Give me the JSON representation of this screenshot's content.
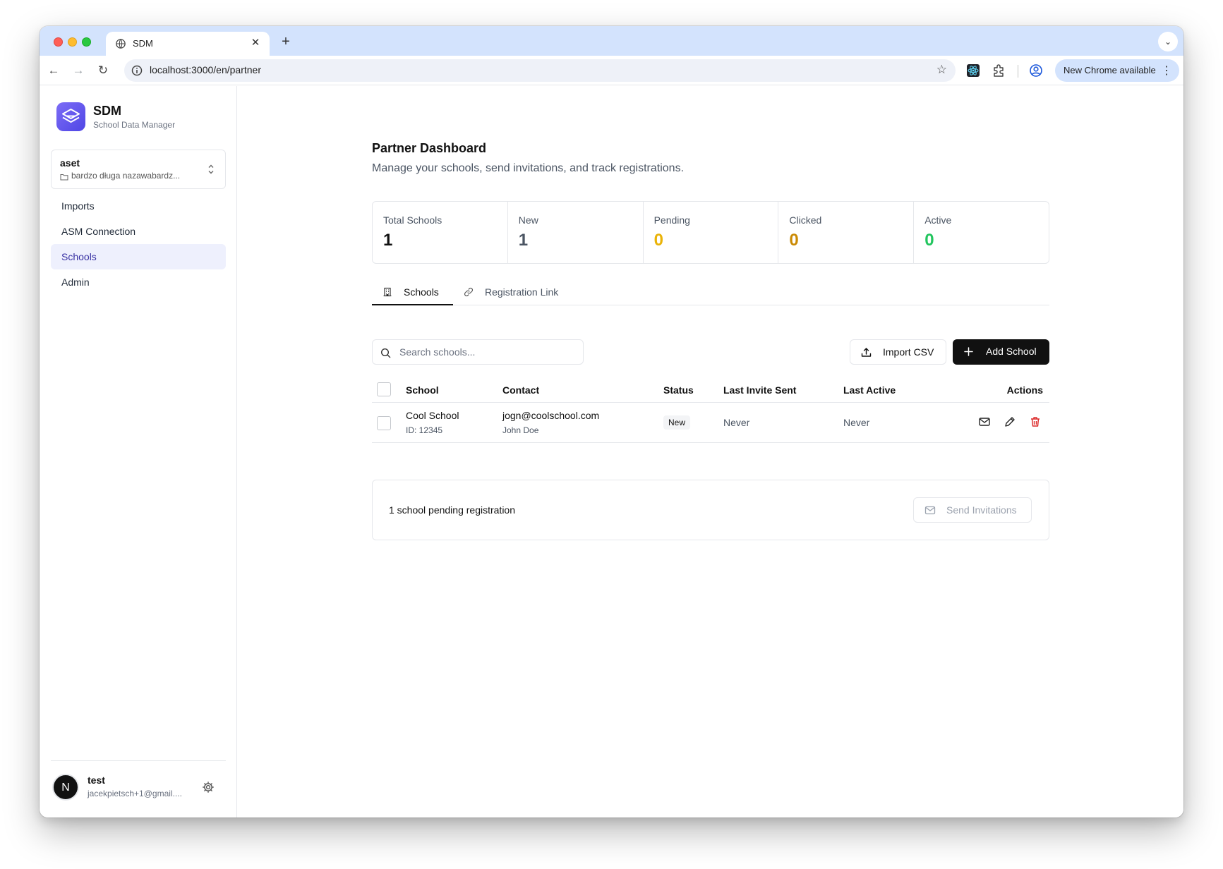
{
  "browser": {
    "tab_title": "SDM",
    "url": "localhost:3000/en/partner",
    "update_label": "New Chrome available"
  },
  "sidebar": {
    "brand_name": "SDM",
    "brand_subtitle": "School Data Manager",
    "org": {
      "name": "aset",
      "path": "bardzo długa nazawabardz..."
    },
    "nav": [
      {
        "label": "Imports"
      },
      {
        "label": "ASM Connection"
      },
      {
        "label": "Schools",
        "active": true
      },
      {
        "label": "Admin"
      }
    ],
    "user": {
      "initial": "N",
      "name": "test",
      "email": "jacekpietsch+1@gmail...."
    }
  },
  "main": {
    "title": "Partner Dashboard",
    "subtitle": "Manage your schools, send invitations, and track registrations.",
    "stats": [
      {
        "label": "Total Schools",
        "value": "1",
        "color": "#111111"
      },
      {
        "label": "New",
        "value": "1",
        "color": "#4b5563"
      },
      {
        "label": "Pending",
        "value": "0",
        "color": "#eab308"
      },
      {
        "label": "Clicked",
        "value": "0",
        "color": "#ca8a04"
      },
      {
        "label": "Active",
        "value": "0",
        "color": "#22c55e"
      }
    ],
    "tabs": [
      {
        "label": "Schools",
        "active": true
      },
      {
        "label": "Registration Link",
        "active": false
      }
    ],
    "search": {
      "placeholder": "Search schools...",
      "value": ""
    },
    "import_label": "Import CSV",
    "add_label": "Add School",
    "table": {
      "headers": [
        "School",
        "Contact",
        "Status",
        "Last Invite Sent",
        "Last Active",
        "Actions"
      ],
      "rows": [
        {
          "school": "Cool School",
          "school_id": "ID: 12345",
          "contact_email": "jogn@coolschool.com",
          "contact_name": "John Doe",
          "status": "New",
          "last_invite": "Never",
          "last_active": "Never"
        }
      ]
    },
    "footer": {
      "text": "1 school pending registration",
      "send_label": "Send Invitations"
    }
  },
  "colors": {
    "accent": "#3730a3",
    "active_nav_bg": "#eef0fd",
    "brand_gradient_start": "#7c6cf6",
    "brand_gradient_end": "#4f46e5",
    "danger": "#dc2626"
  }
}
